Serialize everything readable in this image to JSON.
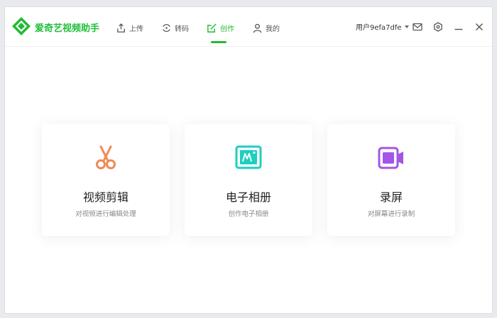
{
  "app": {
    "brand": "爱奇艺视频助手"
  },
  "nav": [
    {
      "label": "上传",
      "icon": "upload-icon"
    },
    {
      "label": "转码",
      "icon": "transcode-icon"
    },
    {
      "label": "创作",
      "icon": "create-icon",
      "active": true
    },
    {
      "label": "我的",
      "icon": "user-icon"
    }
  ],
  "header": {
    "username": "用户9efa7dfe",
    "icons": [
      "mail-icon",
      "settings-icon",
      "minimize-icon",
      "close-icon"
    ]
  },
  "cards": [
    {
      "title": "视频剪辑",
      "subtitle": "对视频进行编辑处理",
      "icon": "scissors-icon"
    },
    {
      "title": "电子相册",
      "subtitle": "创作电子相册",
      "icon": "photo-album-icon"
    },
    {
      "title": "录屏",
      "subtitle": "对屏幕进行录制",
      "icon": "screen-record-icon"
    }
  ],
  "colors": {
    "brand": "#22bb33",
    "scissors": "#f08a56",
    "album": "#1ccfc0",
    "record": "#a355e8"
  }
}
